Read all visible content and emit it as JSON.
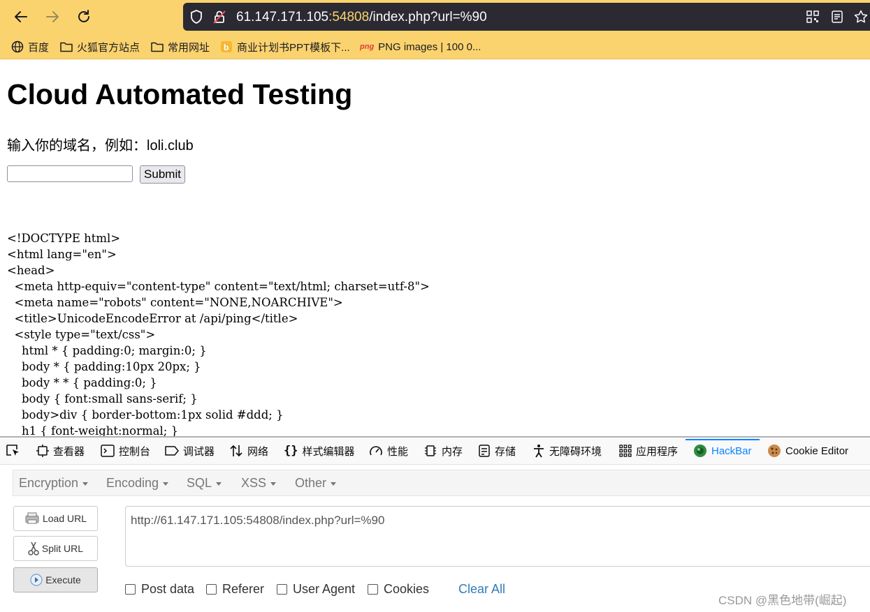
{
  "browser": {
    "url_host": "61.147.171.105",
    "url_port": ":54808",
    "url_path": "/index.php?url=%90",
    "bookmarks": [
      "百度",
      "火狐官方站点",
      "常用网址",
      "商业计划书PPT模板下...",
      "PNG images | 100 0..."
    ],
    "bookmark_png_tag": "png",
    "accent": "#fbd36e"
  },
  "page": {
    "title": "Cloud Automated Testing",
    "prompt": "输入你的域名，例如：loli.club",
    "input_value": "",
    "submit_label": "Submit",
    "source_lines": [
      "<!DOCTYPE html>",
      "<html lang=\"en\">",
      "<head>",
      "  <meta http-equiv=\"content-type\" content=\"text/html; charset=utf-8\">",
      "  <meta name=\"robots\" content=\"NONE,NOARCHIVE\">",
      "  <title>UnicodeEncodeError at /api/ping</title>",
      "  <style type=\"text/css\">",
      "    html * { padding:0; margin:0; }",
      "    body * { padding:10px 20px; }",
      "    body * * { padding:0; }",
      "    body { font:small sans-serif; }",
      "    body>div { border-bottom:1px solid #ddd; }",
      "    h1 { font-weight:normal; }"
    ]
  },
  "devtools": {
    "tabs": [
      "查看器",
      "控制台",
      "调试器",
      "网络",
      "样式编辑器",
      "性能",
      "内存",
      "存储",
      "无障碍环境",
      "应用程序",
      "HackBar",
      "Cookie Editor"
    ],
    "active_tab": "HackBar"
  },
  "hackbar": {
    "menus": [
      "Encryption",
      "Encoding",
      "SQL",
      "XSS",
      "Other"
    ],
    "load_url": "Load URL",
    "split_url": "Split URL",
    "execute": "Execute",
    "url_value": "http://61.147.171.105:54808/index.php?url=%90",
    "options": [
      "Post data",
      "Referer",
      "User Agent",
      "Cookies"
    ],
    "clear_all": "Clear All"
  },
  "watermark": "CSDN @黑色地带(崛起)"
}
